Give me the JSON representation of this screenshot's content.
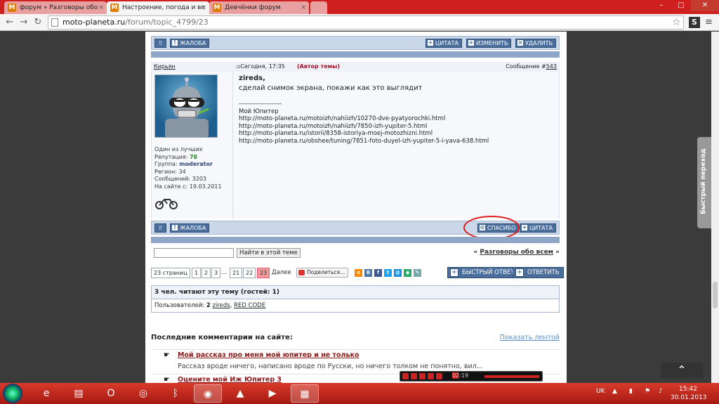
{
  "tabs": [
    {
      "favicon": "M",
      "title": "форум » Разговоры обо",
      "close": "×"
    },
    {
      "favicon": "M",
      "title": "Настроение, погода и вс",
      "close": "×"
    },
    {
      "favicon": "M",
      "title": "Девчёнки форум",
      "close": "×"
    }
  ],
  "window": {
    "minimize": "–",
    "maximize": "□",
    "close": "✕"
  },
  "address": {
    "host": "moto-planeta.ru",
    "path": "/forum/topic_4799/23"
  },
  "top_bar": {
    "complaint": "ЖАЛОБА",
    "quote": "ЦИТАТА",
    "edit": "ИЗМЕНИТЬ",
    "delete": "УДАЛИТЬ"
  },
  "post": {
    "author": "Кирьян",
    "date": "Сегодня, 17:35",
    "author_tag": "(Автор темы)",
    "msg_label": "Сообщение #",
    "msg_number": "543",
    "reply_to": "zireds",
    "text": "сделай снимок экрана, покажи как это выглядит",
    "sig_sep": "--------------------",
    "sig_title": "Мой Юпитер",
    "sig_links": [
      "http://moto-planeta.ru/motoizh/nahiizh/10270-dve-pyatyorochki.html",
      "http://moto-planeta.ru/motoizh/nahiizh/7850-izh-yupiter-5.html",
      "http://moto-planeta.ru/istorii/8358-istoriya-moej-motozhizni.html",
      "http://moto-planeta.ru/obshee/tuning/7851-foto-duyel-izh-yupiter-5-i-yava-638.html"
    ],
    "info": {
      "rank": "Один из лучших",
      "reputation_label": "Репутация:",
      "reputation": "78",
      "group_label": "Группа:",
      "group": "moderator",
      "region": "Регион: 34",
      "messages": "Сообщений: 3203",
      "since": "На сайте с: 19.03.2011"
    }
  },
  "bottom_bar": {
    "complaint": "ЖАЛОБА",
    "thanks": "СПАСИБО",
    "quote": "ЦИТАТА"
  },
  "search": {
    "button": "Найти в этой теме",
    "prev": "«",
    "forum": "Разговоры обо всем",
    "next": "»"
  },
  "pager": {
    "label": "23 страниц",
    "pages": [
      "1",
      "2",
      "3",
      "...",
      "21",
      "22",
      "23"
    ],
    "current": "23",
    "next": "Далее",
    "share": "Поделиться...",
    "quick_reply": "БЫСТРЫЙ ОТВЕТ",
    "reply": "ОТВЕТИТЬ"
  },
  "readers": {
    "title": "3 чел. читают эту тему (гостей: 1)",
    "users_label": "Пользователей:",
    "users_count": "2",
    "users": [
      "zireds",
      "RED CODE"
    ]
  },
  "comments": {
    "heading": "Последние комментарии на сайте:",
    "feed_link": "Показать лентой",
    "items": [
      {
        "title": "Мой рассказ про меня мой юпитер и не только",
        "desc": "Рассказ вроде ничего, написано вроде по Русски, но ничего толком не понятно, вил..."
      },
      {
        "title": "Оцените мой Иж Юпитер 3"
      }
    ]
  },
  "side": {
    "quick_nav": "Быстрый переход",
    "to_top": "⌃"
  },
  "media": {
    "time": "02:19"
  },
  "taskbar": {
    "lang": "UK",
    "time": "15:42",
    "date": "30.01.2013"
  },
  "colors": {
    "accent": "#4a6f9d",
    "taskbar": "#c42a1c",
    "highlight": "#e01818"
  }
}
